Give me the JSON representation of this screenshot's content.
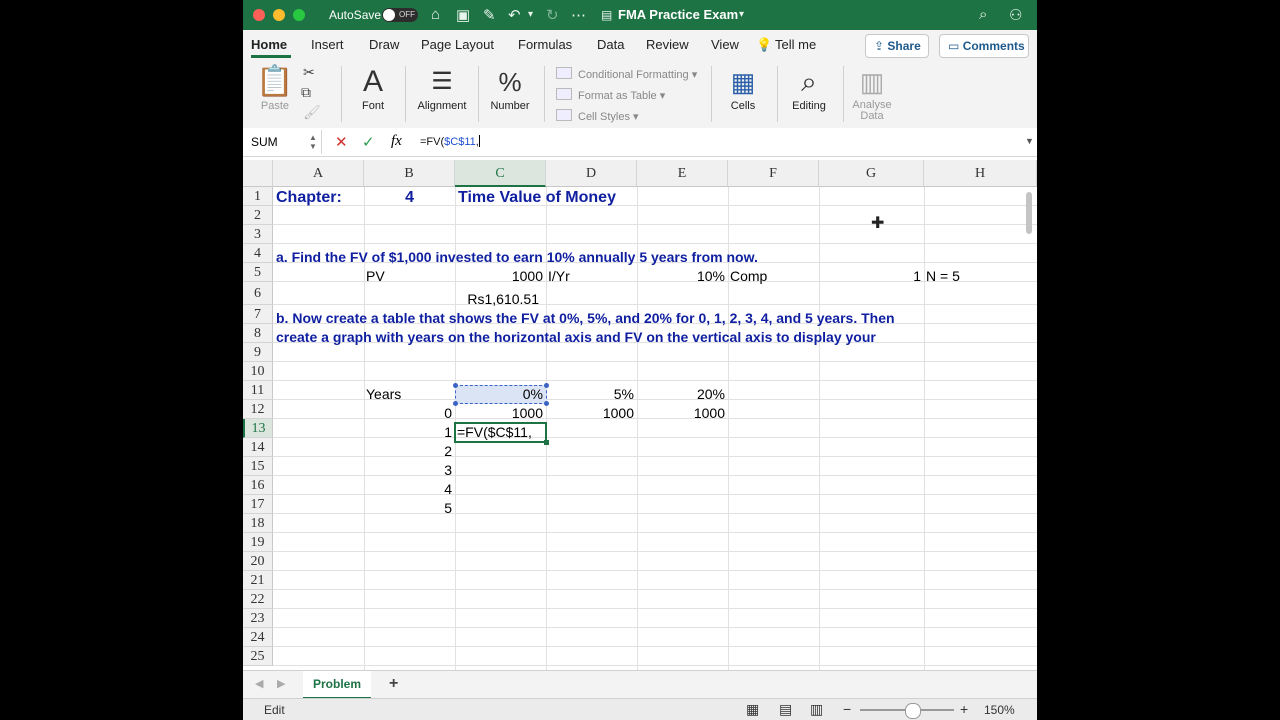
{
  "titlebar": {
    "autosave_label": "AutoSave",
    "autosave_state": "OFF",
    "doc_title": "FMA Practice Exam"
  },
  "tabs": [
    "Home",
    "Insert",
    "Draw",
    "Page Layout",
    "Formulas",
    "Data",
    "Review",
    "View",
    "Tell me"
  ],
  "share_label": "Share",
  "comments_label": "Comments",
  "ribbon": {
    "paste": "Paste",
    "font": "Font",
    "alignment": "Alignment",
    "number": "Number",
    "conditional_formatting": "Conditional Formatting",
    "format_as_table": "Format as Table",
    "cell_styles": "Cell Styles",
    "cells": "Cells",
    "editing": "Editing",
    "analyse_data_1": "Analyse",
    "analyse_data_2": "Data"
  },
  "formula_bar": {
    "name_box": "SUM",
    "fx": "fx",
    "formula_prefix": "=FV(",
    "formula_ref": "$C$11",
    "formula_suffix": ","
  },
  "columns": [
    "A",
    "B",
    "C",
    "D",
    "E",
    "F",
    "G",
    "H"
  ],
  "rows": [
    "1",
    "2",
    "3",
    "4",
    "5",
    "6",
    "7",
    "8",
    "9",
    "10",
    "11",
    "12",
    "13",
    "14",
    "15",
    "16",
    "17",
    "18",
    "19",
    "20",
    "21",
    "22",
    "23",
    "24",
    "25"
  ],
  "cells": {
    "A1": "Chapter:",
    "B1": "4",
    "C1": "Time Value of Money",
    "A4": "a.   Find the FV of $1,000 invested to earn 10% annually 5 years from now.",
    "B5": "PV",
    "C5": "1000",
    "D5": "I/Yr",
    "E5": "10%",
    "F5": "Comp",
    "G5": "1",
    "H5": "N = 5",
    "C6": "Rs1,610.51",
    "A7": "b.   Now create a table that shows the FV at 0%, 5%, and 20% for 0, 1, 2, 3, 4, and 5 years.  Then",
    "A8": "create a graph with years on the horizontal axis and FV on the vertical axis to display your",
    "B11": "Years",
    "C11": "0%",
    "D11": "5%",
    "E11": "20%",
    "B12": "0",
    "C12": "1000",
    "D12": "1000",
    "E12": "1000",
    "B13": "1",
    "C13": "=FV($C$11,",
    "B14": "2",
    "B15": "3",
    "B16": "4",
    "B17": "5"
  },
  "sheet_tab": "Problem",
  "add_sheet": "+",
  "status": {
    "mode": "Edit",
    "zoom": "150%"
  },
  "colors": {
    "excel_green": "#1e7345",
    "heading_blue": "#0f1fa0"
  }
}
